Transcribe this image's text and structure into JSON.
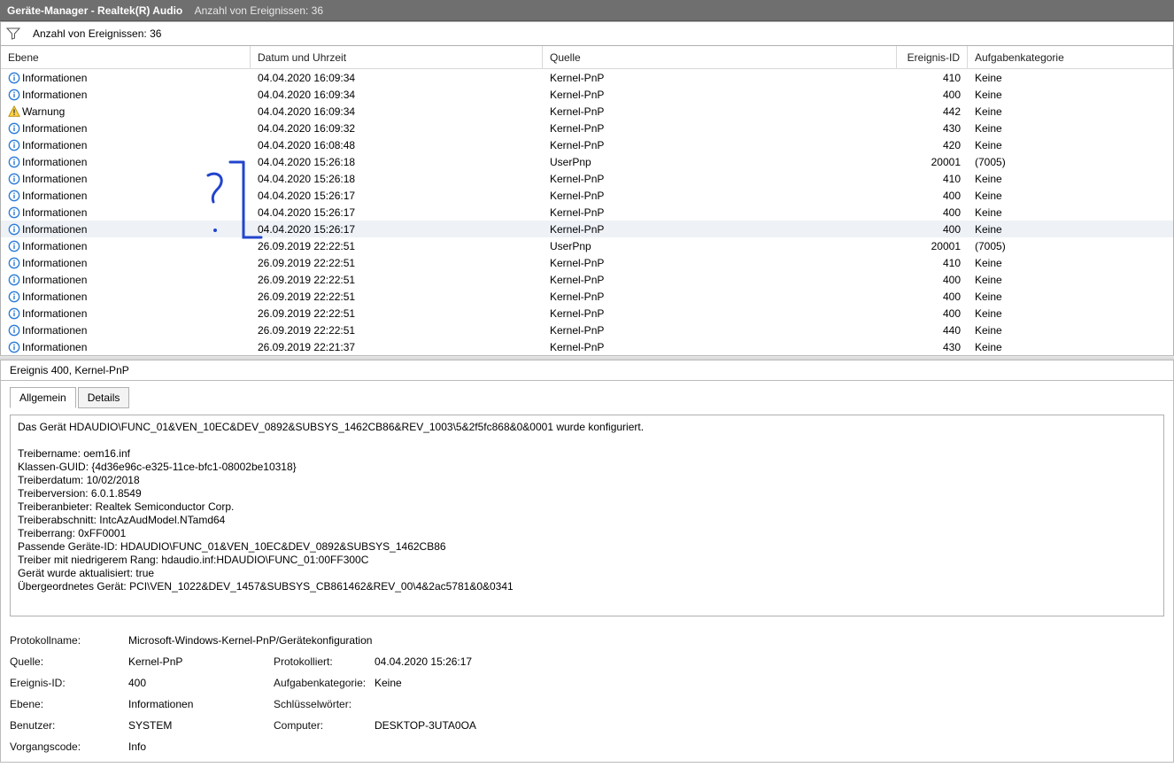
{
  "titlebar": {
    "main": "Geräte-Manager - Realtek(R) Audio",
    "sub": "Anzahl von Ereignissen: 36"
  },
  "toolbar": {
    "count_text": "Anzahl von Ereignissen: 36"
  },
  "columns": {
    "level": "Ebene",
    "date": "Datum und Uhrzeit",
    "source": "Quelle",
    "id": "Ereignis-ID",
    "category": "Aufgabenkategorie"
  },
  "level_labels": {
    "info": "Informationen",
    "warn": "Warnung"
  },
  "rows": [
    {
      "lvl": "info",
      "date": "04.04.2020 16:09:34",
      "src": "Kernel-PnP",
      "id": "410",
      "cat": "Keine"
    },
    {
      "lvl": "info",
      "date": "04.04.2020 16:09:34",
      "src": "Kernel-PnP",
      "id": "400",
      "cat": "Keine"
    },
    {
      "lvl": "warn",
      "date": "04.04.2020 16:09:34",
      "src": "Kernel-PnP",
      "id": "442",
      "cat": "Keine"
    },
    {
      "lvl": "info",
      "date": "04.04.2020 16:09:32",
      "src": "Kernel-PnP",
      "id": "430",
      "cat": "Keine"
    },
    {
      "lvl": "info",
      "date": "04.04.2020 16:08:48",
      "src": "Kernel-PnP",
      "id": "420",
      "cat": "Keine"
    },
    {
      "lvl": "info",
      "date": "04.04.2020 15:26:18",
      "src": "UserPnp",
      "id": "20001",
      "cat": "(7005)"
    },
    {
      "lvl": "info",
      "date": "04.04.2020 15:26:18",
      "src": "Kernel-PnP",
      "id": "410",
      "cat": "Keine"
    },
    {
      "lvl": "info",
      "date": "04.04.2020 15:26:17",
      "src": "Kernel-PnP",
      "id": "400",
      "cat": "Keine"
    },
    {
      "lvl": "info",
      "date": "04.04.2020 15:26:17",
      "src": "Kernel-PnP",
      "id": "400",
      "cat": "Keine"
    },
    {
      "lvl": "info",
      "date": "04.04.2020 15:26:17",
      "src": "Kernel-PnP",
      "id": "400",
      "cat": "Keine",
      "selected": true
    },
    {
      "lvl": "info",
      "date": "26.09.2019 22:22:51",
      "src": "UserPnp",
      "id": "20001",
      "cat": "(7005)"
    },
    {
      "lvl": "info",
      "date": "26.09.2019 22:22:51",
      "src": "Kernel-PnP",
      "id": "410",
      "cat": "Keine"
    },
    {
      "lvl": "info",
      "date": "26.09.2019 22:22:51",
      "src": "Kernel-PnP",
      "id": "400",
      "cat": "Keine"
    },
    {
      "lvl": "info",
      "date": "26.09.2019 22:22:51",
      "src": "Kernel-PnP",
      "id": "400",
      "cat": "Keine"
    },
    {
      "lvl": "info",
      "date": "26.09.2019 22:22:51",
      "src": "Kernel-PnP",
      "id": "400",
      "cat": "Keine"
    },
    {
      "lvl": "info",
      "date": "26.09.2019 22:22:51",
      "src": "Kernel-PnP",
      "id": "440",
      "cat": "Keine"
    },
    {
      "lvl": "info",
      "date": "26.09.2019 22:21:37",
      "src": "Kernel-PnP",
      "id": "430",
      "cat": "Keine"
    }
  ],
  "detail": {
    "header": "Ereignis 400, Kernel-PnP",
    "tabs": {
      "general": "Allgemein",
      "details": "Details"
    },
    "text": "Das Gerät HDAUDIO\\FUNC_01&VEN_10EC&DEV_0892&SUBSYS_1462CB86&REV_1003\\5&2f5fc868&0&0001 wurde konfiguriert.\n\nTreibername: oem16.inf\nKlassen-GUID: {4d36e96c-e325-11ce-bfc1-08002be10318}\nTreiberdatum: 10/02/2018\nTreiberversion: 6.0.1.8549\nTreiberanbieter: Realtek Semiconductor Corp.\nTreiberabschnitt: IntcAzAudModel.NTamd64\nTreiberrang: 0xFF0001\nPassende Geräte-ID: HDAUDIO\\FUNC_01&VEN_10EC&DEV_0892&SUBSYS_1462CB86\nTreiber mit niedrigerem Rang: hdaudio.inf:HDAUDIO\\FUNC_01:00FF300C\nGerät wurde aktualisiert: true\nÜbergeordnetes Gerät: PCI\\VEN_1022&DEV_1457&SUBSYS_CB861462&REV_00\\4&2ac5781&0&0341",
    "grid": {
      "log_name_l": "Protokollname:",
      "log_name_v": "Microsoft-Windows-Kernel-PnP/Gerätekonfiguration",
      "source_l": "Quelle:",
      "source_v": "Kernel-PnP",
      "logged_l": "Protokolliert:",
      "logged_v": "04.04.2020 15:26:17",
      "eventid_l": "Ereignis-ID:",
      "eventid_v": "400",
      "taskcat_l": "Aufgabenkategorie:",
      "taskcat_v": "Keine",
      "level_l": "Ebene:",
      "level_v": "Informationen",
      "keywords_l": "Schlüsselwörter:",
      "keywords_v": "",
      "user_l": "Benutzer:",
      "user_v": "SYSTEM",
      "computer_l": "Computer:",
      "computer_v": "DESKTOP-3UTA0OA",
      "opcode_l": "Vorgangscode:",
      "opcode_v": "Info"
    }
  }
}
